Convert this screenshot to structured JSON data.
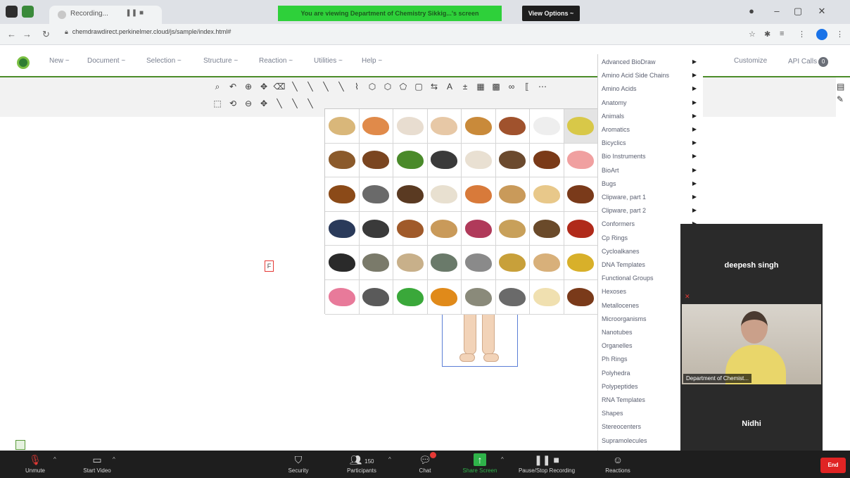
{
  "browser": {
    "tab_title": "Recording...",
    "share_banner": "You are viewing Department of Chemistry Sikkig...'s screen",
    "view_options": "View Options ~",
    "url": "chemdrawdirect.perkinelmer.cloud/js/sample/index.html#"
  },
  "menubar": {
    "items": [
      "New ~",
      "Document ~",
      "Selection ~",
      "Structure ~",
      "Reaction ~",
      "Utilities ~",
      "Help ~"
    ],
    "customize": "Customize",
    "api_calls": "API Calls",
    "api_badge": "0"
  },
  "canvas": {
    "atom_label": "F"
  },
  "library_menu": {
    "items": [
      {
        "label": "Advanced BioDraw",
        "arrow": true
      },
      {
        "label": "Amino Acid Side Chains",
        "arrow": true
      },
      {
        "label": "Amino Acids",
        "arrow": true
      },
      {
        "label": "Anatomy",
        "arrow": true
      },
      {
        "label": "Animals",
        "arrow": true
      },
      {
        "label": "Aromatics",
        "arrow": true
      },
      {
        "label": "Bicyclics",
        "arrow": true
      },
      {
        "label": "Bio Instruments",
        "arrow": true
      },
      {
        "label": "BioArt",
        "arrow": true
      },
      {
        "label": "Bugs",
        "arrow": true
      },
      {
        "label": "Clipware, part 1",
        "arrow": true
      },
      {
        "label": "Clipware, part 2",
        "arrow": true
      },
      {
        "label": "Conformers",
        "arrow": true
      },
      {
        "label": "Cp Rings",
        "arrow": false
      },
      {
        "label": "Cycloalkanes",
        "arrow": false
      },
      {
        "label": "DNA Templates",
        "arrow": false
      },
      {
        "label": "Functional Groups",
        "arrow": false
      },
      {
        "label": "Hexoses",
        "arrow": false
      },
      {
        "label": "Metallocenes",
        "arrow": false
      },
      {
        "label": "Microorganisms",
        "arrow": false
      },
      {
        "label": "Nanotubes",
        "arrow": false
      },
      {
        "label": "Organelles",
        "arrow": false
      },
      {
        "label": "Ph Rings",
        "arrow": false
      },
      {
        "label": "Polyhedra",
        "arrow": false
      },
      {
        "label": "Polypeptides",
        "arrow": false
      },
      {
        "label": "RNA Templates",
        "arrow": false
      },
      {
        "label": "Shapes",
        "arrow": false
      },
      {
        "label": "Stereocenters",
        "arrow": false
      },
      {
        "label": "Supramolecules",
        "arrow": false
      }
    ]
  },
  "video_panel": {
    "participant_1": "deepesh singh",
    "participant_2_caption": "Department of Chemist...",
    "participant_3": "Nidhi"
  },
  "zoom_bar": {
    "unmute": "Unmute",
    "start_video": "Start Video",
    "security": "Security",
    "participants": "Participants",
    "participant_count": "150",
    "chat": "Chat",
    "share_screen": "Share Screen",
    "pause_recording": "Pause/Stop Recording",
    "reactions": "Reactions",
    "end": "End"
  },
  "colors": {
    "share_banner": "#2ed03a",
    "accent_green": "#4c8c2a",
    "zoom_bar": "#1e1e1e",
    "end_button": "#e02424"
  }
}
